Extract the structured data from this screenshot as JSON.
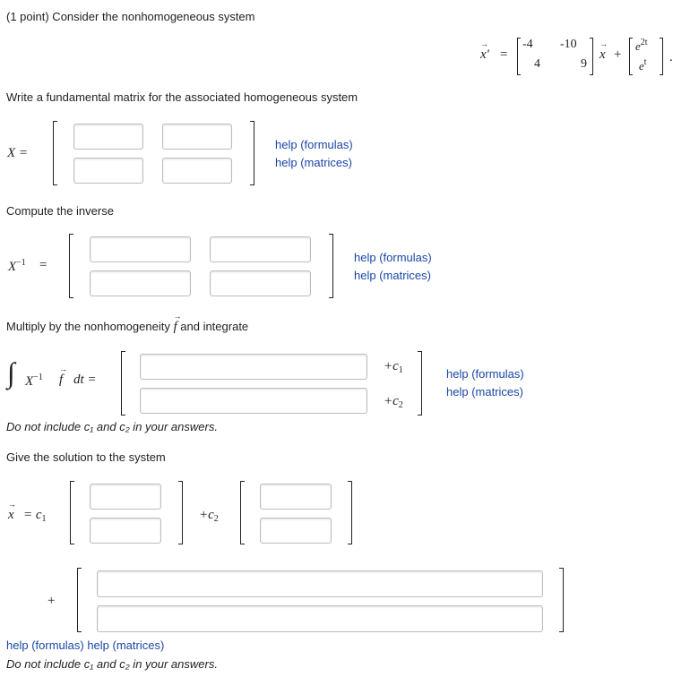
{
  "problem": {
    "header": "(1 point) Consider the nonhomogeneous system",
    "system_matrix": [
      "-4",
      "-10",
      "4",
      "9"
    ],
    "forcing": [
      "e^2t",
      "e^t"
    ],
    "forcing_exp_1": "2t",
    "forcing_exp_2": "t"
  },
  "part1": {
    "prompt": "Write a fundamental matrix for the associated homogeneous system",
    "label": "X ="
  },
  "part2": {
    "prompt": "Compute the inverse",
    "label_base": "X",
    "label_sup": "−1"
  },
  "part3": {
    "prompt_before": "Multiply by the nonhomogeneity",
    "prompt_symbol": "f",
    "prompt_after": "and integrate",
    "c1": "+c",
    "c2": "+c",
    "note": "Do not include c₁ and c₂ in your answers."
  },
  "part4": {
    "prompt": "Give the solution to the system",
    "c1_label": "= c",
    "c2_label": "+c",
    "plus": "+"
  },
  "help": {
    "formulas": "help (formulas)",
    "matrices": "help (matrices)"
  },
  "footer_note": "Do not include c₁ and c₂ in your answers.",
  "fields": {
    "X11": "",
    "X12": "",
    "X21": "",
    "X22": "",
    "Xi11": "",
    "Xi12": "",
    "Xi21": "",
    "Xi22": "",
    "int1": "",
    "int2": "",
    "y1a": "",
    "y1b": "",
    "y2a": "",
    "y2b": "",
    "p1": "",
    "p2": ""
  }
}
